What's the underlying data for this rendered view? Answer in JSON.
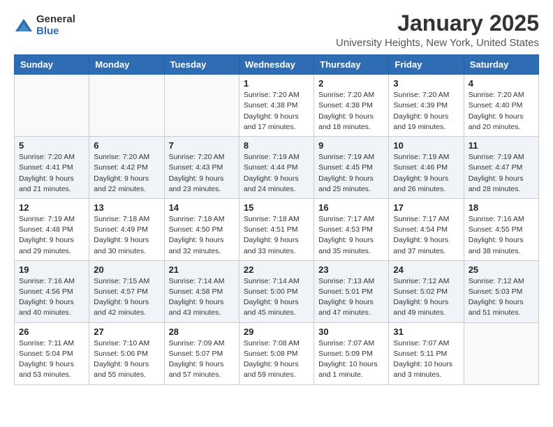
{
  "logo": {
    "general": "General",
    "blue": "Blue"
  },
  "title": "January 2025",
  "location": "University Heights, New York, United States",
  "weekdays": [
    "Sunday",
    "Monday",
    "Tuesday",
    "Wednesday",
    "Thursday",
    "Friday",
    "Saturday"
  ],
  "weeks": [
    [
      {
        "day": "",
        "info": ""
      },
      {
        "day": "",
        "info": ""
      },
      {
        "day": "",
        "info": ""
      },
      {
        "day": "1",
        "info": "Sunrise: 7:20 AM\nSunset: 4:38 PM\nDaylight: 9 hours\nand 17 minutes."
      },
      {
        "day": "2",
        "info": "Sunrise: 7:20 AM\nSunset: 4:38 PM\nDaylight: 9 hours\nand 18 minutes."
      },
      {
        "day": "3",
        "info": "Sunrise: 7:20 AM\nSunset: 4:39 PM\nDaylight: 9 hours\nand 19 minutes."
      },
      {
        "day": "4",
        "info": "Sunrise: 7:20 AM\nSunset: 4:40 PM\nDaylight: 9 hours\nand 20 minutes."
      }
    ],
    [
      {
        "day": "5",
        "info": "Sunrise: 7:20 AM\nSunset: 4:41 PM\nDaylight: 9 hours\nand 21 minutes."
      },
      {
        "day": "6",
        "info": "Sunrise: 7:20 AM\nSunset: 4:42 PM\nDaylight: 9 hours\nand 22 minutes."
      },
      {
        "day": "7",
        "info": "Sunrise: 7:20 AM\nSunset: 4:43 PM\nDaylight: 9 hours\nand 23 minutes."
      },
      {
        "day": "8",
        "info": "Sunrise: 7:19 AM\nSunset: 4:44 PM\nDaylight: 9 hours\nand 24 minutes."
      },
      {
        "day": "9",
        "info": "Sunrise: 7:19 AM\nSunset: 4:45 PM\nDaylight: 9 hours\nand 25 minutes."
      },
      {
        "day": "10",
        "info": "Sunrise: 7:19 AM\nSunset: 4:46 PM\nDaylight: 9 hours\nand 26 minutes."
      },
      {
        "day": "11",
        "info": "Sunrise: 7:19 AM\nSunset: 4:47 PM\nDaylight: 9 hours\nand 28 minutes."
      }
    ],
    [
      {
        "day": "12",
        "info": "Sunrise: 7:19 AM\nSunset: 4:48 PM\nDaylight: 9 hours\nand 29 minutes."
      },
      {
        "day": "13",
        "info": "Sunrise: 7:18 AM\nSunset: 4:49 PM\nDaylight: 9 hours\nand 30 minutes."
      },
      {
        "day": "14",
        "info": "Sunrise: 7:18 AM\nSunset: 4:50 PM\nDaylight: 9 hours\nand 32 minutes."
      },
      {
        "day": "15",
        "info": "Sunrise: 7:18 AM\nSunset: 4:51 PM\nDaylight: 9 hours\nand 33 minutes."
      },
      {
        "day": "16",
        "info": "Sunrise: 7:17 AM\nSunset: 4:53 PM\nDaylight: 9 hours\nand 35 minutes."
      },
      {
        "day": "17",
        "info": "Sunrise: 7:17 AM\nSunset: 4:54 PM\nDaylight: 9 hours\nand 37 minutes."
      },
      {
        "day": "18",
        "info": "Sunrise: 7:16 AM\nSunset: 4:55 PM\nDaylight: 9 hours\nand 38 minutes."
      }
    ],
    [
      {
        "day": "19",
        "info": "Sunrise: 7:16 AM\nSunset: 4:56 PM\nDaylight: 9 hours\nand 40 minutes."
      },
      {
        "day": "20",
        "info": "Sunrise: 7:15 AM\nSunset: 4:57 PM\nDaylight: 9 hours\nand 42 minutes."
      },
      {
        "day": "21",
        "info": "Sunrise: 7:14 AM\nSunset: 4:58 PM\nDaylight: 9 hours\nand 43 minutes."
      },
      {
        "day": "22",
        "info": "Sunrise: 7:14 AM\nSunset: 5:00 PM\nDaylight: 9 hours\nand 45 minutes."
      },
      {
        "day": "23",
        "info": "Sunrise: 7:13 AM\nSunset: 5:01 PM\nDaylight: 9 hours\nand 47 minutes."
      },
      {
        "day": "24",
        "info": "Sunrise: 7:12 AM\nSunset: 5:02 PM\nDaylight: 9 hours\nand 49 minutes."
      },
      {
        "day": "25",
        "info": "Sunrise: 7:12 AM\nSunset: 5:03 PM\nDaylight: 9 hours\nand 51 minutes."
      }
    ],
    [
      {
        "day": "26",
        "info": "Sunrise: 7:11 AM\nSunset: 5:04 PM\nDaylight: 9 hours\nand 53 minutes."
      },
      {
        "day": "27",
        "info": "Sunrise: 7:10 AM\nSunset: 5:06 PM\nDaylight: 9 hours\nand 55 minutes."
      },
      {
        "day": "28",
        "info": "Sunrise: 7:09 AM\nSunset: 5:07 PM\nDaylight: 9 hours\nand 57 minutes."
      },
      {
        "day": "29",
        "info": "Sunrise: 7:08 AM\nSunset: 5:08 PM\nDaylight: 9 hours\nand 59 minutes."
      },
      {
        "day": "30",
        "info": "Sunrise: 7:07 AM\nSunset: 5:09 PM\nDaylight: 10 hours\nand 1 minute."
      },
      {
        "day": "31",
        "info": "Sunrise: 7:07 AM\nSunset: 5:11 PM\nDaylight: 10 hours\nand 3 minutes."
      },
      {
        "day": "",
        "info": ""
      }
    ]
  ]
}
